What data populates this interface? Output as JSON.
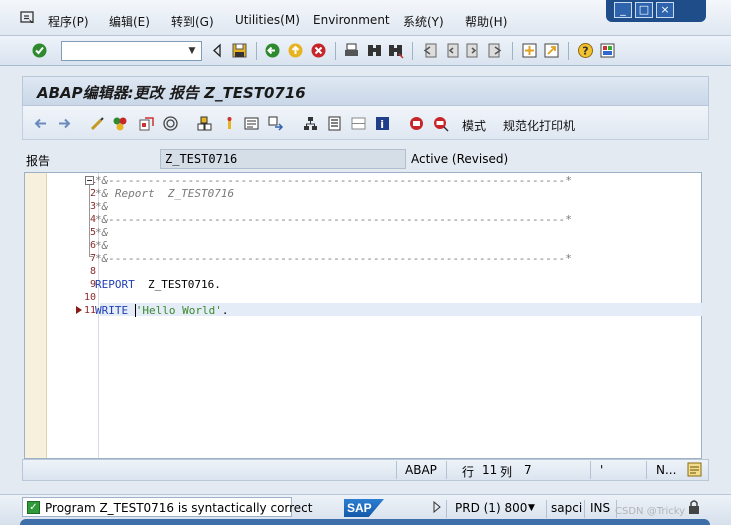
{
  "menu": {
    "items": [
      {
        "label": "程序(P)"
      },
      {
        "label": "编辑(E)"
      },
      {
        "label": "转到(G)"
      },
      {
        "label": "Utilities(M)"
      },
      {
        "label": "Environment"
      },
      {
        "label": "系统(Y)"
      },
      {
        "label": "帮助(H)"
      }
    ]
  },
  "window_controls": {
    "minimize": "_",
    "maximize": "□",
    "close": "×"
  },
  "toolbar": {
    "command_field": {
      "value": "",
      "placeholder": ""
    },
    "icons": [
      "enter-icon",
      "back-icon",
      "save-icon",
      "back-arrow-icon",
      "exit-icon",
      "cancel-icon",
      "print-icon",
      "find-icon",
      "find-next-icon",
      "first-page-icon",
      "prev-page-icon",
      "next-page-icon",
      "last-page-icon",
      "new-session-icon",
      "shortcut-icon",
      "help-icon",
      "layout-icon"
    ]
  },
  "title": {
    "text": "ABAP编辑器:更改 报告 Z_TEST0716"
  },
  "app_toolbar": {
    "mode_label": "模式",
    "pretty_printer_label": "规范化打印机"
  },
  "object": {
    "label": "报告",
    "name": "Z_TEST0716",
    "status": "Active (Revised)"
  },
  "editor": {
    "lines": [
      {
        "n": "1",
        "text": "*&---------------------------------------------------------------------*",
        "type": "comment"
      },
      {
        "n": "2",
        "text": "*& Report  Z_TEST0716",
        "type": "comment"
      },
      {
        "n": "3",
        "text": "*&",
        "type": "comment"
      },
      {
        "n": "4",
        "text": "*&---------------------------------------------------------------------*",
        "type": "comment"
      },
      {
        "n": "5",
        "text": "*&",
        "type": "comment"
      },
      {
        "n": "6",
        "text": "*&",
        "type": "comment"
      },
      {
        "n": "7",
        "text": "*&---------------------------------------------------------------------*",
        "type": "comment"
      },
      {
        "n": "8",
        "text": "",
        "type": "blank"
      },
      {
        "n": "9",
        "kw": "REPORT",
        "rest": "  Z_TEST0716.",
        "type": "code"
      },
      {
        "n": "10",
        "text": "",
        "type": "blank"
      },
      {
        "n": "11",
        "kw": "WRITE",
        "str": "'Hello World'",
        "rest": ".",
        "type": "code"
      }
    ]
  },
  "editor_status": {
    "language": "ABAP",
    "row_label": "行",
    "row": "11",
    "col_label": "列",
    "col": "7",
    "quote": "'",
    "mode": "N..."
  },
  "status": {
    "message": "Program Z_TEST0716 is syntactically correct",
    "system": "PRD (1) 800",
    "server": "sapci",
    "insert_mode": "INS",
    "logo": "SAP",
    "watermark": "CSDN @Tricky"
  },
  "colors": {
    "keyword": "#1f3fb5",
    "string": "#3c8a2a",
    "comment": "#7a7a7a",
    "line_number": "#8a2a2a"
  }
}
